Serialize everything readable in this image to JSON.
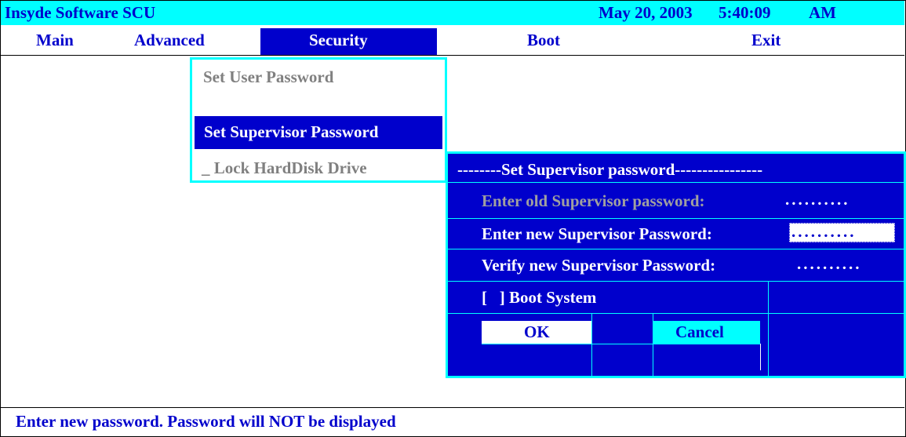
{
  "header": {
    "app_title": "Insyde Software SCU",
    "date": "May 20, 2003",
    "time": "5:40:09",
    "ampm": "AM"
  },
  "menu": {
    "main": "Main",
    "advanced": "Advanced",
    "security": "Security",
    "boot": "Boot",
    "exit": "Exit"
  },
  "security_menu": {
    "set_user_password": "Set User Password",
    "set_supervisor_password": "Set Supervisor Password",
    "lock_harddisk": "_ Lock HardDisk Drive"
  },
  "dialog": {
    "title": "--------Set Supervisor password----------------",
    "old_label": "Enter old Supervisor password:",
    "old_value": "..........",
    "new_label": "Enter new Supervisor Password:",
    "new_value": "..........",
    "verify_label": "Verify new Supervisor Password:",
    "verify_value": "..........",
    "boot_system": "[   ] Boot System",
    "ok": "OK",
    "cancel": "Cancel"
  },
  "status": {
    "help_text": "Enter new password. Password will NOT be displayed"
  },
  "colors": {
    "accent_blue": "#0000cc",
    "cyan": "#00ffff",
    "disabled_gray": "#808080"
  }
}
